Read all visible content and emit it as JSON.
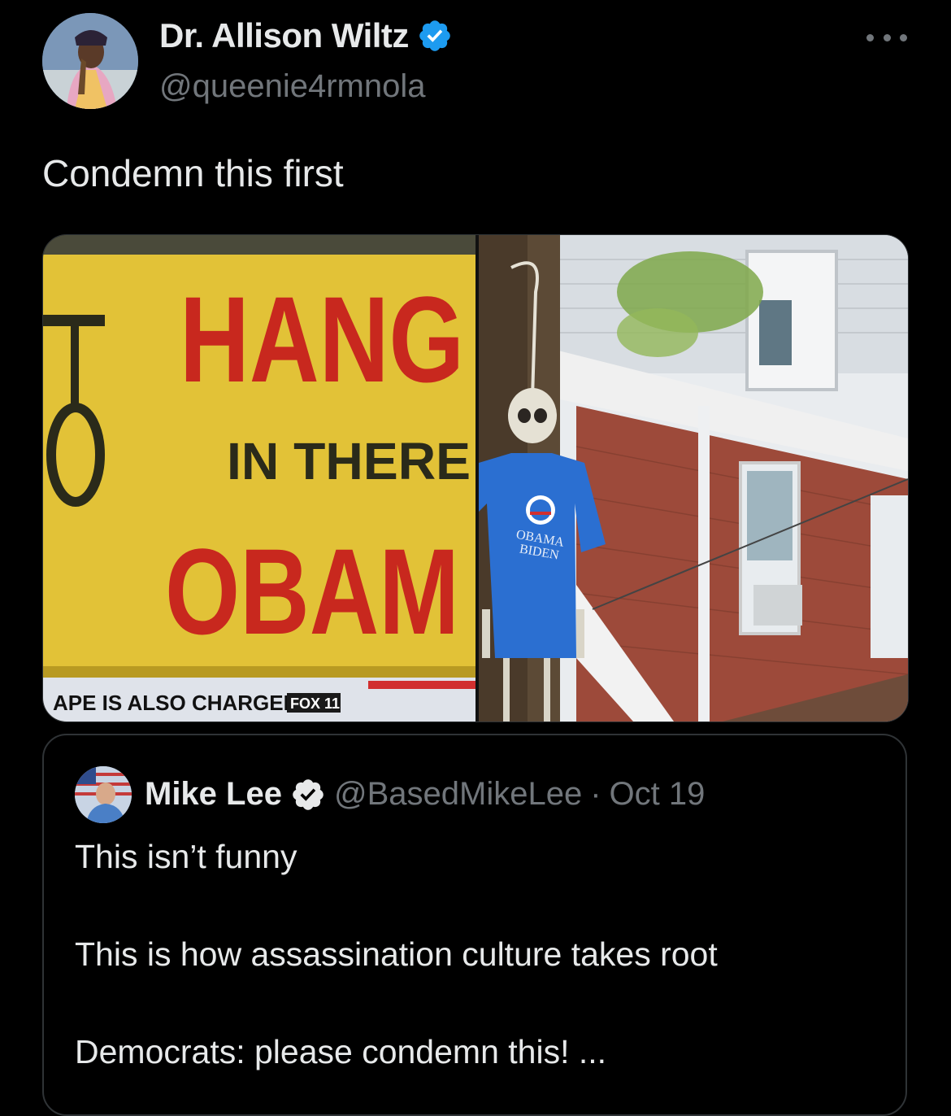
{
  "author": {
    "display_name": "Dr. Allison Wiltz",
    "handle": "@queenie4rmnola",
    "verified": true
  },
  "more_menu_icon": "more-horizontal-icon",
  "tweet": {
    "text": "Condemn this first"
  },
  "media": {
    "left_image": {
      "sign_line1": "HANG",
      "sign_line2": "IN THERE",
      "sign_line3": "OBAM",
      "ticker": "APE IS ALSO CHARGED",
      "channel_logo": "FOX 11"
    },
    "right_image": {
      "shirt_text_1": "OBAMA",
      "shirt_text_2": "BIDEN"
    }
  },
  "quoted_tweet": {
    "display_name": "Mike Lee",
    "handle": "@BasedMikeLee",
    "separator": "·",
    "date": "Oct 19",
    "line1": "This isn’t funny",
    "line2": "This is how assassination culture takes root",
    "line3": "Democrats: please condemn this!  ..."
  },
  "colors": {
    "background": "#000000",
    "text_primary": "#e7e9ea",
    "text_secondary": "#71767b",
    "verified_blue": "#1d9bf0",
    "border": "#2f3336"
  }
}
